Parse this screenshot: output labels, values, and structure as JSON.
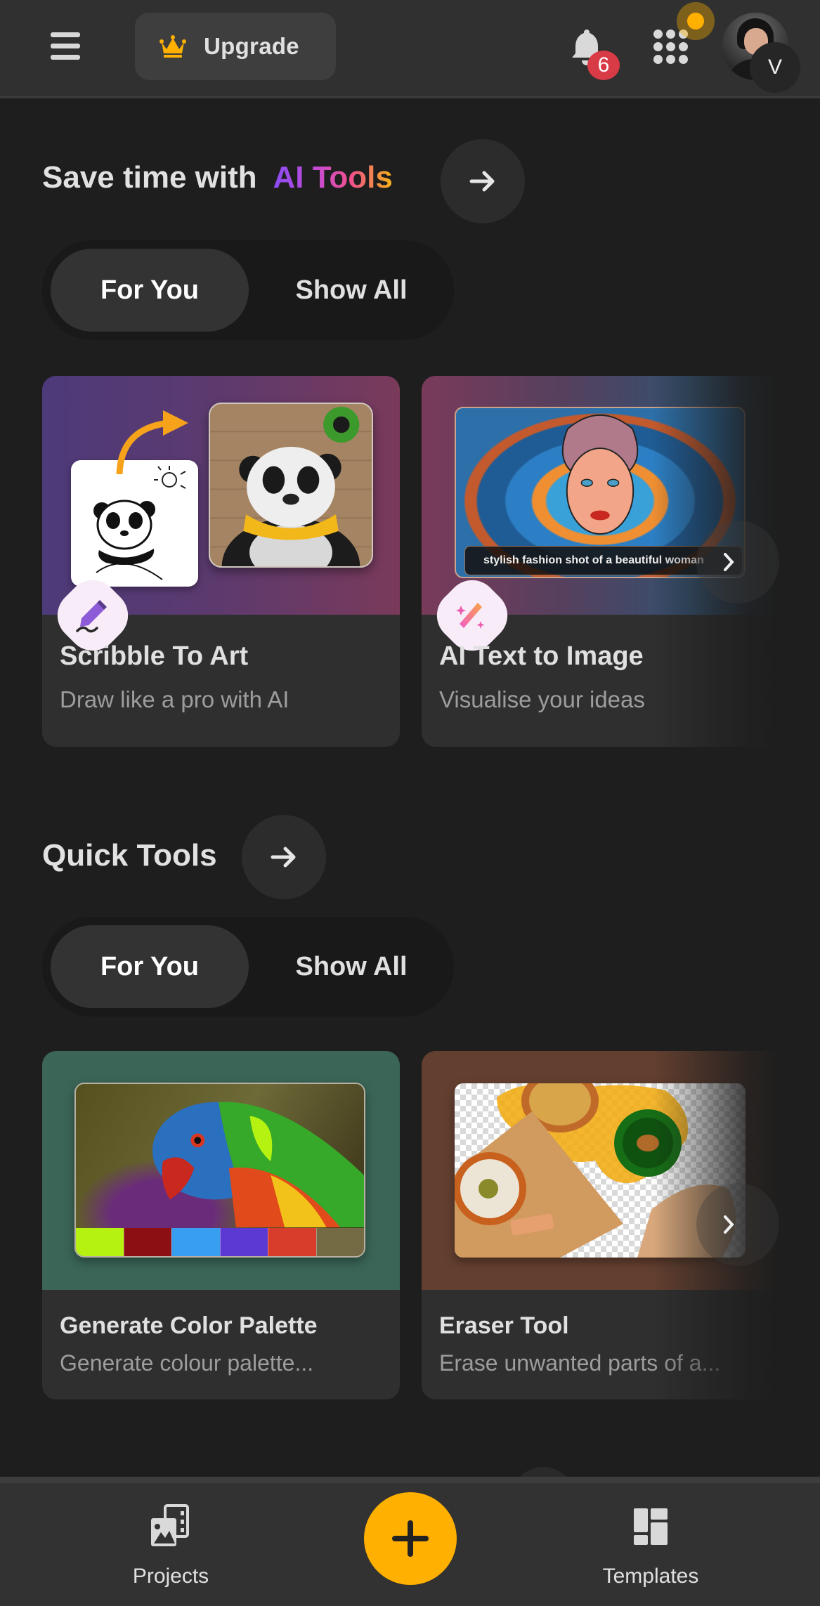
{
  "header": {
    "menu_icon": "hamburger-menu-icon",
    "upgrade_label": "Upgrade",
    "upgrade_icon": "crown-icon",
    "notifications_icon": "bell-icon",
    "notification_count": "6",
    "apps_icon": "grid-dots-icon",
    "avatar_initial": "V",
    "colors": {
      "accent": "#ffb000",
      "badge": "#d83a46"
    }
  },
  "ai_tools": {
    "title_prefix": "Save time with",
    "title_highlight": "AI Tools",
    "arrow_icon": "arrow-right-icon",
    "tabs": [
      {
        "label": "For You",
        "active": true
      },
      {
        "label": "Show All",
        "active": false
      }
    ],
    "cards": [
      {
        "title": "Scribble To Art",
        "subtitle": "Draw like a pro with AI",
        "icon": "pencil-scribble-icon"
      },
      {
        "title": "AI Text to Image",
        "subtitle": "Visualise your ideas",
        "icon": "magic-wand-icon",
        "prompt_text": "stylish fashion shot of a beautiful woman"
      }
    ]
  },
  "quick_tools": {
    "title": "Quick Tools",
    "arrow_icon": "arrow-right-icon",
    "tabs": [
      {
        "label": "For You",
        "active": true
      },
      {
        "label": "Show All",
        "active": false
      }
    ],
    "cards": [
      {
        "title": "Generate Color Palette",
        "subtitle": "Generate colour palette...",
        "palette": [
          "#b5f212",
          "#8c0f14",
          "#389ff0",
          "#5b3ad4",
          "#d83c2a",
          "#746a44"
        ]
      },
      {
        "title": "Eraser Tool",
        "subtitle": "Erase unwanted parts of a..."
      }
    ]
  },
  "bottom_nav": {
    "items": [
      {
        "label": "Projects",
        "icon": "projects-media-icon"
      },
      {
        "label": "Templates",
        "icon": "templates-layout-icon"
      }
    ],
    "fab_icon": "plus-icon"
  }
}
